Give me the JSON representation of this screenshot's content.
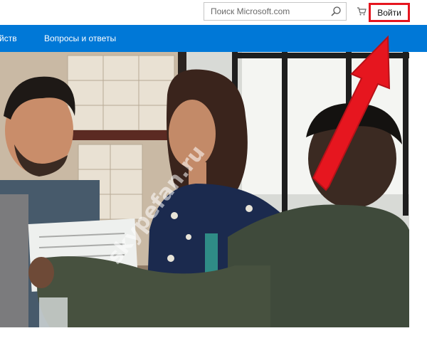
{
  "header": {
    "search": {
      "placeholder": "Поиск Microsoft.com"
    },
    "signin_label": "Войти"
  },
  "nav": {
    "items": [
      {
        "label": "йств"
      },
      {
        "label": "Вопросы и ответы"
      }
    ]
  },
  "hero": {
    "watermark": "skypefan.ru"
  },
  "colors": {
    "nav_blue": "#0078d7",
    "annotation_red": "#e6161f"
  }
}
